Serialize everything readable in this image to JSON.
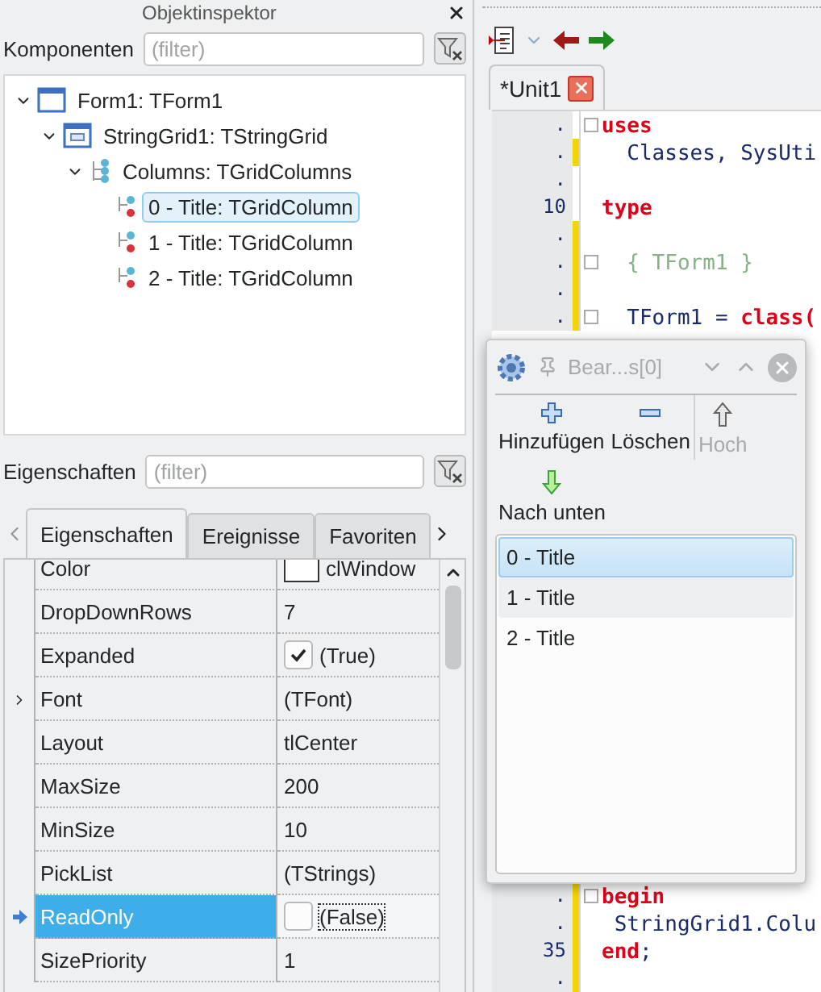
{
  "inspector": {
    "title": "Objektinspektor",
    "components_label": "Komponenten",
    "components_filter": {
      "placeholder": "(filter)"
    },
    "tree": [
      {
        "label": "Form1: TForm1",
        "kind": "form",
        "selected": false,
        "expanded": true,
        "children": [
          {
            "label": "StringGrid1: TStringGrid",
            "kind": "grid",
            "selected": false,
            "expanded": true,
            "children": [
              {
                "label": "Columns: TGridColumns",
                "kind": "collection",
                "selected": false,
                "expanded": true,
                "children": [
                  {
                    "label": "0 - Title: TGridColumn",
                    "kind": "item",
                    "selected": true
                  },
                  {
                    "label": "1 - Title: TGridColumn",
                    "kind": "item",
                    "selected": false
                  },
                  {
                    "label": "2 - Title: TGridColumn",
                    "kind": "item",
                    "selected": false
                  }
                ]
              }
            ]
          }
        ]
      }
    ],
    "properties_label": "Eigenschaften",
    "properties_filter": {
      "placeholder": "(filter)"
    },
    "tabs": [
      {
        "label": "Eigenschaften",
        "selected": true
      },
      {
        "label": "Ereignisse",
        "selected": false
      },
      {
        "label": "Favoriten",
        "selected": false
      }
    ],
    "properties": [
      {
        "name": "Color",
        "value": "clWindow",
        "kind": "color",
        "selected": false
      },
      {
        "name": "DropDownRows",
        "value": "7",
        "kind": "text",
        "selected": false
      },
      {
        "name": "Expanded",
        "value": "(True)",
        "kind": "bool",
        "checked": true,
        "selected": false
      },
      {
        "name": "Font",
        "value": "(TFont)",
        "kind": "object",
        "selected": false
      },
      {
        "name": "Layout",
        "value": "tlCenter",
        "kind": "text",
        "selected": false
      },
      {
        "name": "MaxSize",
        "value": "200",
        "kind": "text",
        "selected": false
      },
      {
        "name": "MinSize",
        "value": "10",
        "kind": "text",
        "selected": false
      },
      {
        "name": "PickList",
        "value": "(TStrings)",
        "kind": "text",
        "selected": false
      },
      {
        "name": "ReadOnly",
        "value": "(False)",
        "kind": "bool",
        "checked": false,
        "selected": true
      },
      {
        "name": "SizePriority",
        "value": "1",
        "kind": "text",
        "selected": false
      }
    ]
  },
  "editor": {
    "tabs": [
      {
        "label": "*Unit1",
        "selected": true
      }
    ],
    "top_lines": [
      {
        "number": ".",
        "modified": false,
        "fold": true,
        "segments": [
          {
            "text": "uses",
            "kind": "keyword"
          }
        ]
      },
      {
        "number": ".",
        "modified": true,
        "fold": false,
        "segments": [
          {
            "text": "  Classes, SysUti",
            "kind": "plain"
          }
        ]
      },
      {
        "number": ".",
        "modified": false,
        "fold": false
      },
      {
        "number": "10",
        "modified": false,
        "fold": false,
        "segments": [
          {
            "text": "type",
            "kind": "keyword"
          }
        ]
      },
      {
        "number": ".",
        "modified": true,
        "fold": false
      },
      {
        "number": ".",
        "modified": true,
        "fold": true,
        "segments": [
          {
            "text": "  { TForm1 }",
            "kind": "comment"
          }
        ]
      },
      {
        "number": ".",
        "modified": true,
        "fold": false
      },
      {
        "number": ".",
        "modified": true,
        "fold": true,
        "segments": [
          {
            "text": "  TForm1 = ",
            "kind": "plain"
          },
          {
            "text": "class(",
            "kind": "keyword"
          }
        ]
      }
    ],
    "bottom_lines": [
      {
        "number": ".",
        "modified": true,
        "fold": true,
        "segments": [
          {
            "text": "begin",
            "kind": "keyword"
          }
        ]
      },
      {
        "number": ".",
        "modified": true,
        "fold": false,
        "segments": [
          {
            "text": " StringGrid1.Colu",
            "kind": "plain"
          }
        ]
      },
      {
        "number": "35",
        "modified": true,
        "fold": false,
        "segments": [
          {
            "text": "end",
            "kind": "keyword"
          },
          {
            "text": ";",
            "kind": "plain"
          }
        ]
      },
      {
        "number": ".",
        "modified": true,
        "fold": false
      }
    ]
  },
  "dialog": {
    "title": "Bear...s[0]",
    "buttons": [
      {
        "label": "Hinzufügen",
        "kind": "add",
        "disabled": false
      },
      {
        "label": "Löschen",
        "kind": "delete",
        "disabled": false
      },
      {
        "label": "Hoch",
        "kind": "up",
        "disabled": true
      },
      {
        "label": "Nach unten",
        "kind": "down",
        "disabled": false
      }
    ],
    "items": [
      {
        "label": "0 - Title",
        "selected": true,
        "hovered": false
      },
      {
        "label": "1 - Title",
        "selected": false,
        "hovered": true
      },
      {
        "label": "2 - Title",
        "selected": false,
        "hovered": false
      }
    ]
  }
}
